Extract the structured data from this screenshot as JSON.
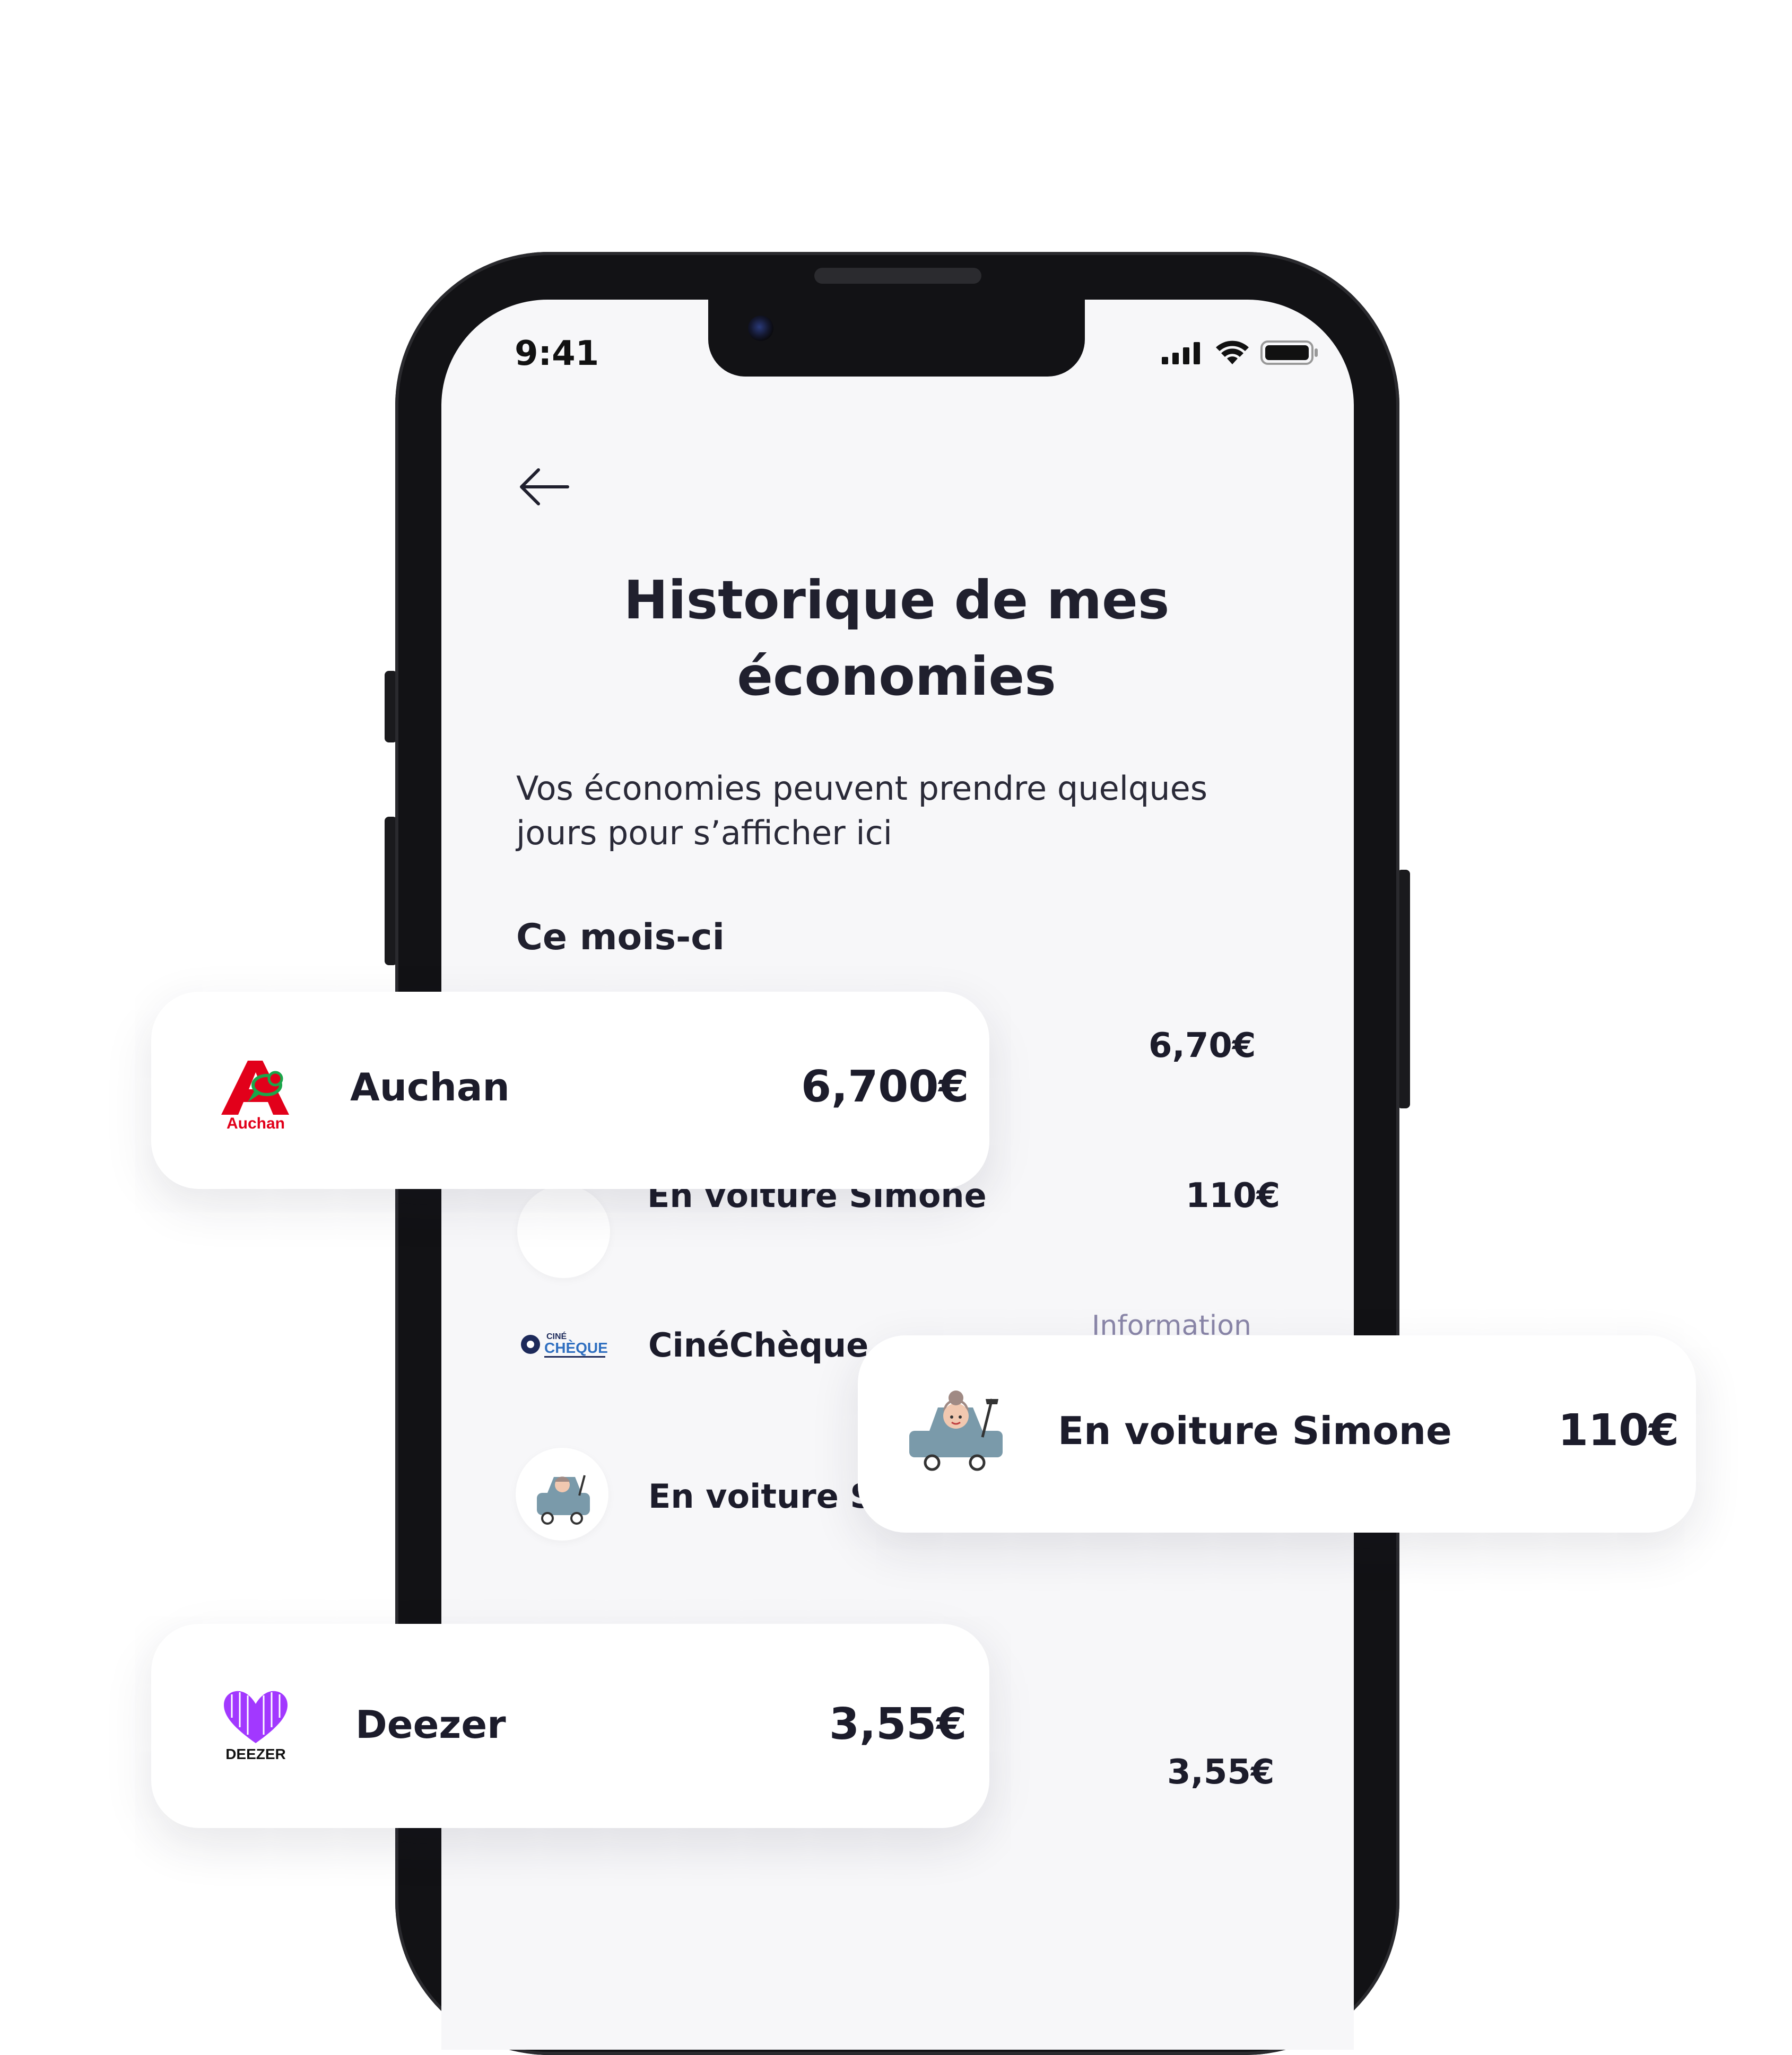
{
  "status_bar": {
    "time": "9:41"
  },
  "header": {
    "title": "Historique de mes économies",
    "subtitle": "Vos économies peuvent prendre quelques jours pour s’afficher ici"
  },
  "section": {
    "label": "Ce mois-ci"
  },
  "list": [
    {
      "name": "",
      "amount": "6,70€"
    },
    {
      "name": "En voiture Simone",
      "amount": "110€"
    },
    {
      "name": "CinéChèque",
      "amount": "",
      "info": "Information"
    },
    {
      "name": "En voiture Simone",
      "amount": ""
    },
    {
      "name": "",
      "amount": "3,55€"
    }
  ],
  "cards": [
    {
      "name": "Auchan",
      "amount": "6,700€",
      "logo_text": "Auchan",
      "logo_icon": "auchan-logo",
      "brand_color": "#e2001a"
    },
    {
      "name": "En voiture Simone",
      "amount": "110€",
      "logo_icon": "car-illustration"
    },
    {
      "name": "Deezer",
      "amount": "3,55€",
      "logo_text": "DEEZER",
      "logo_icon": "deezer-logo",
      "brand_color": "#a238ff"
    }
  ],
  "cinecheque_logo": {
    "top": "CINÉ",
    "bottom": "CHÈQUE"
  }
}
